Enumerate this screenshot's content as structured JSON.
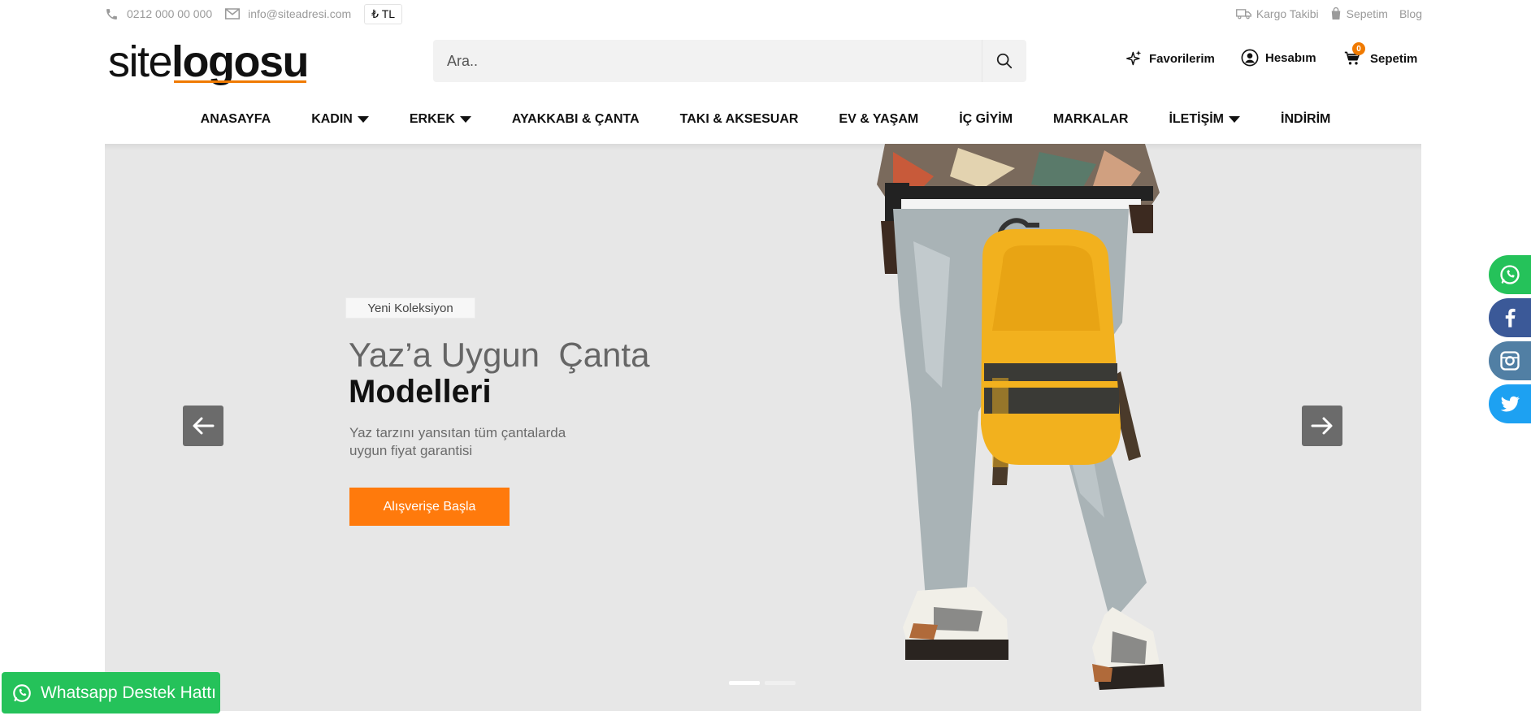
{
  "topbar": {
    "phone": "0212 000 00 000",
    "email": "info@siteadresi.com",
    "currency": "₺ TL",
    "links": [
      {
        "label": "Kargo Takibi",
        "icon": "truck-icon"
      },
      {
        "label": "Sepetim",
        "icon": "bag-icon"
      },
      {
        "label": "Blog"
      }
    ]
  },
  "logo": {
    "part1": "site",
    "part2": "logosu"
  },
  "search": {
    "placeholder": "Ara.."
  },
  "header_links": {
    "favorites": "Favorilerim",
    "account": "Hesabım",
    "cart": "Sepetim",
    "cart_count": "0"
  },
  "nav": [
    {
      "label": "ANASAYFA",
      "dropdown": false
    },
    {
      "label": "KADIN",
      "dropdown": true
    },
    {
      "label": "ERKEK",
      "dropdown": true
    },
    {
      "label": "AYAKKABI & ÇANTA",
      "dropdown": false
    },
    {
      "label": "TAKI & AKSESUAR",
      "dropdown": false
    },
    {
      "label": "EV & YAŞAM",
      "dropdown": false
    },
    {
      "label": "İÇ GİYİM",
      "dropdown": false
    },
    {
      "label": "MARKALAR",
      "dropdown": false
    },
    {
      "label": "İLETİŞİM",
      "dropdown": true
    },
    {
      "label": "İNDİRİM",
      "dropdown": false
    }
  ],
  "hero": {
    "badge": "Yeni Koleksiyon",
    "title_line1": "Yaz’a Uygun  Çanta",
    "title_line2": "Modelleri",
    "desc_line1": "Yaz tarzını yansıtan tüm çantalarda",
    "desc_line2": "uygun fiyat garantisi",
    "cta": "Alışverişe Başla",
    "active_slide": 1,
    "slide_count": 2
  },
  "social": [
    {
      "name": "whatsapp",
      "color": "#25c25a"
    },
    {
      "name": "facebook",
      "color": "#3b5998"
    },
    {
      "name": "instagram",
      "color": "#517fa4"
    },
    {
      "name": "twitter",
      "color": "#1da1f2"
    }
  ],
  "whatsapp_support": "Whatsapp Destek Hattı",
  "colors": {
    "accent": "#ff7a0c",
    "whatsapp": "#25c25a"
  }
}
